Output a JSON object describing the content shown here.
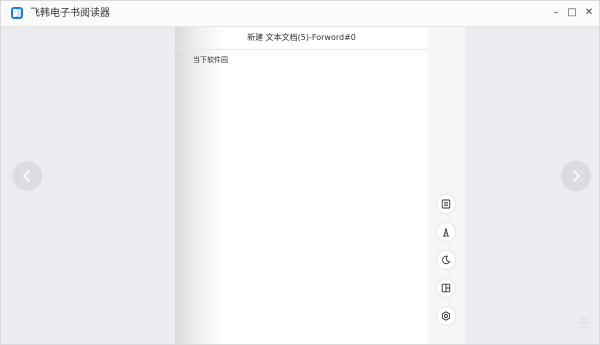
{
  "window": {
    "title": "飞韩电子书阅读器",
    "controls": {
      "minimize": "–",
      "maximize": "□",
      "close": "✕"
    }
  },
  "reader": {
    "header": "新建 文本文档(5)-Forword#0",
    "page_text": "当下软件园"
  },
  "toolbar": {
    "buttons": [
      {
        "name": "table-of-contents-icon"
      },
      {
        "name": "font-settings-icon"
      },
      {
        "name": "night-mode-icon"
      },
      {
        "name": "layout-icon"
      },
      {
        "name": "settings-icon"
      }
    ]
  },
  "navigation": {
    "prev": "chevron-left-icon",
    "next": "chevron-right-icon"
  },
  "colors": {
    "accent": "#1d7cf2",
    "background": "#ebecf0",
    "page": "#ffffff",
    "rail": "#f6f6f7"
  }
}
